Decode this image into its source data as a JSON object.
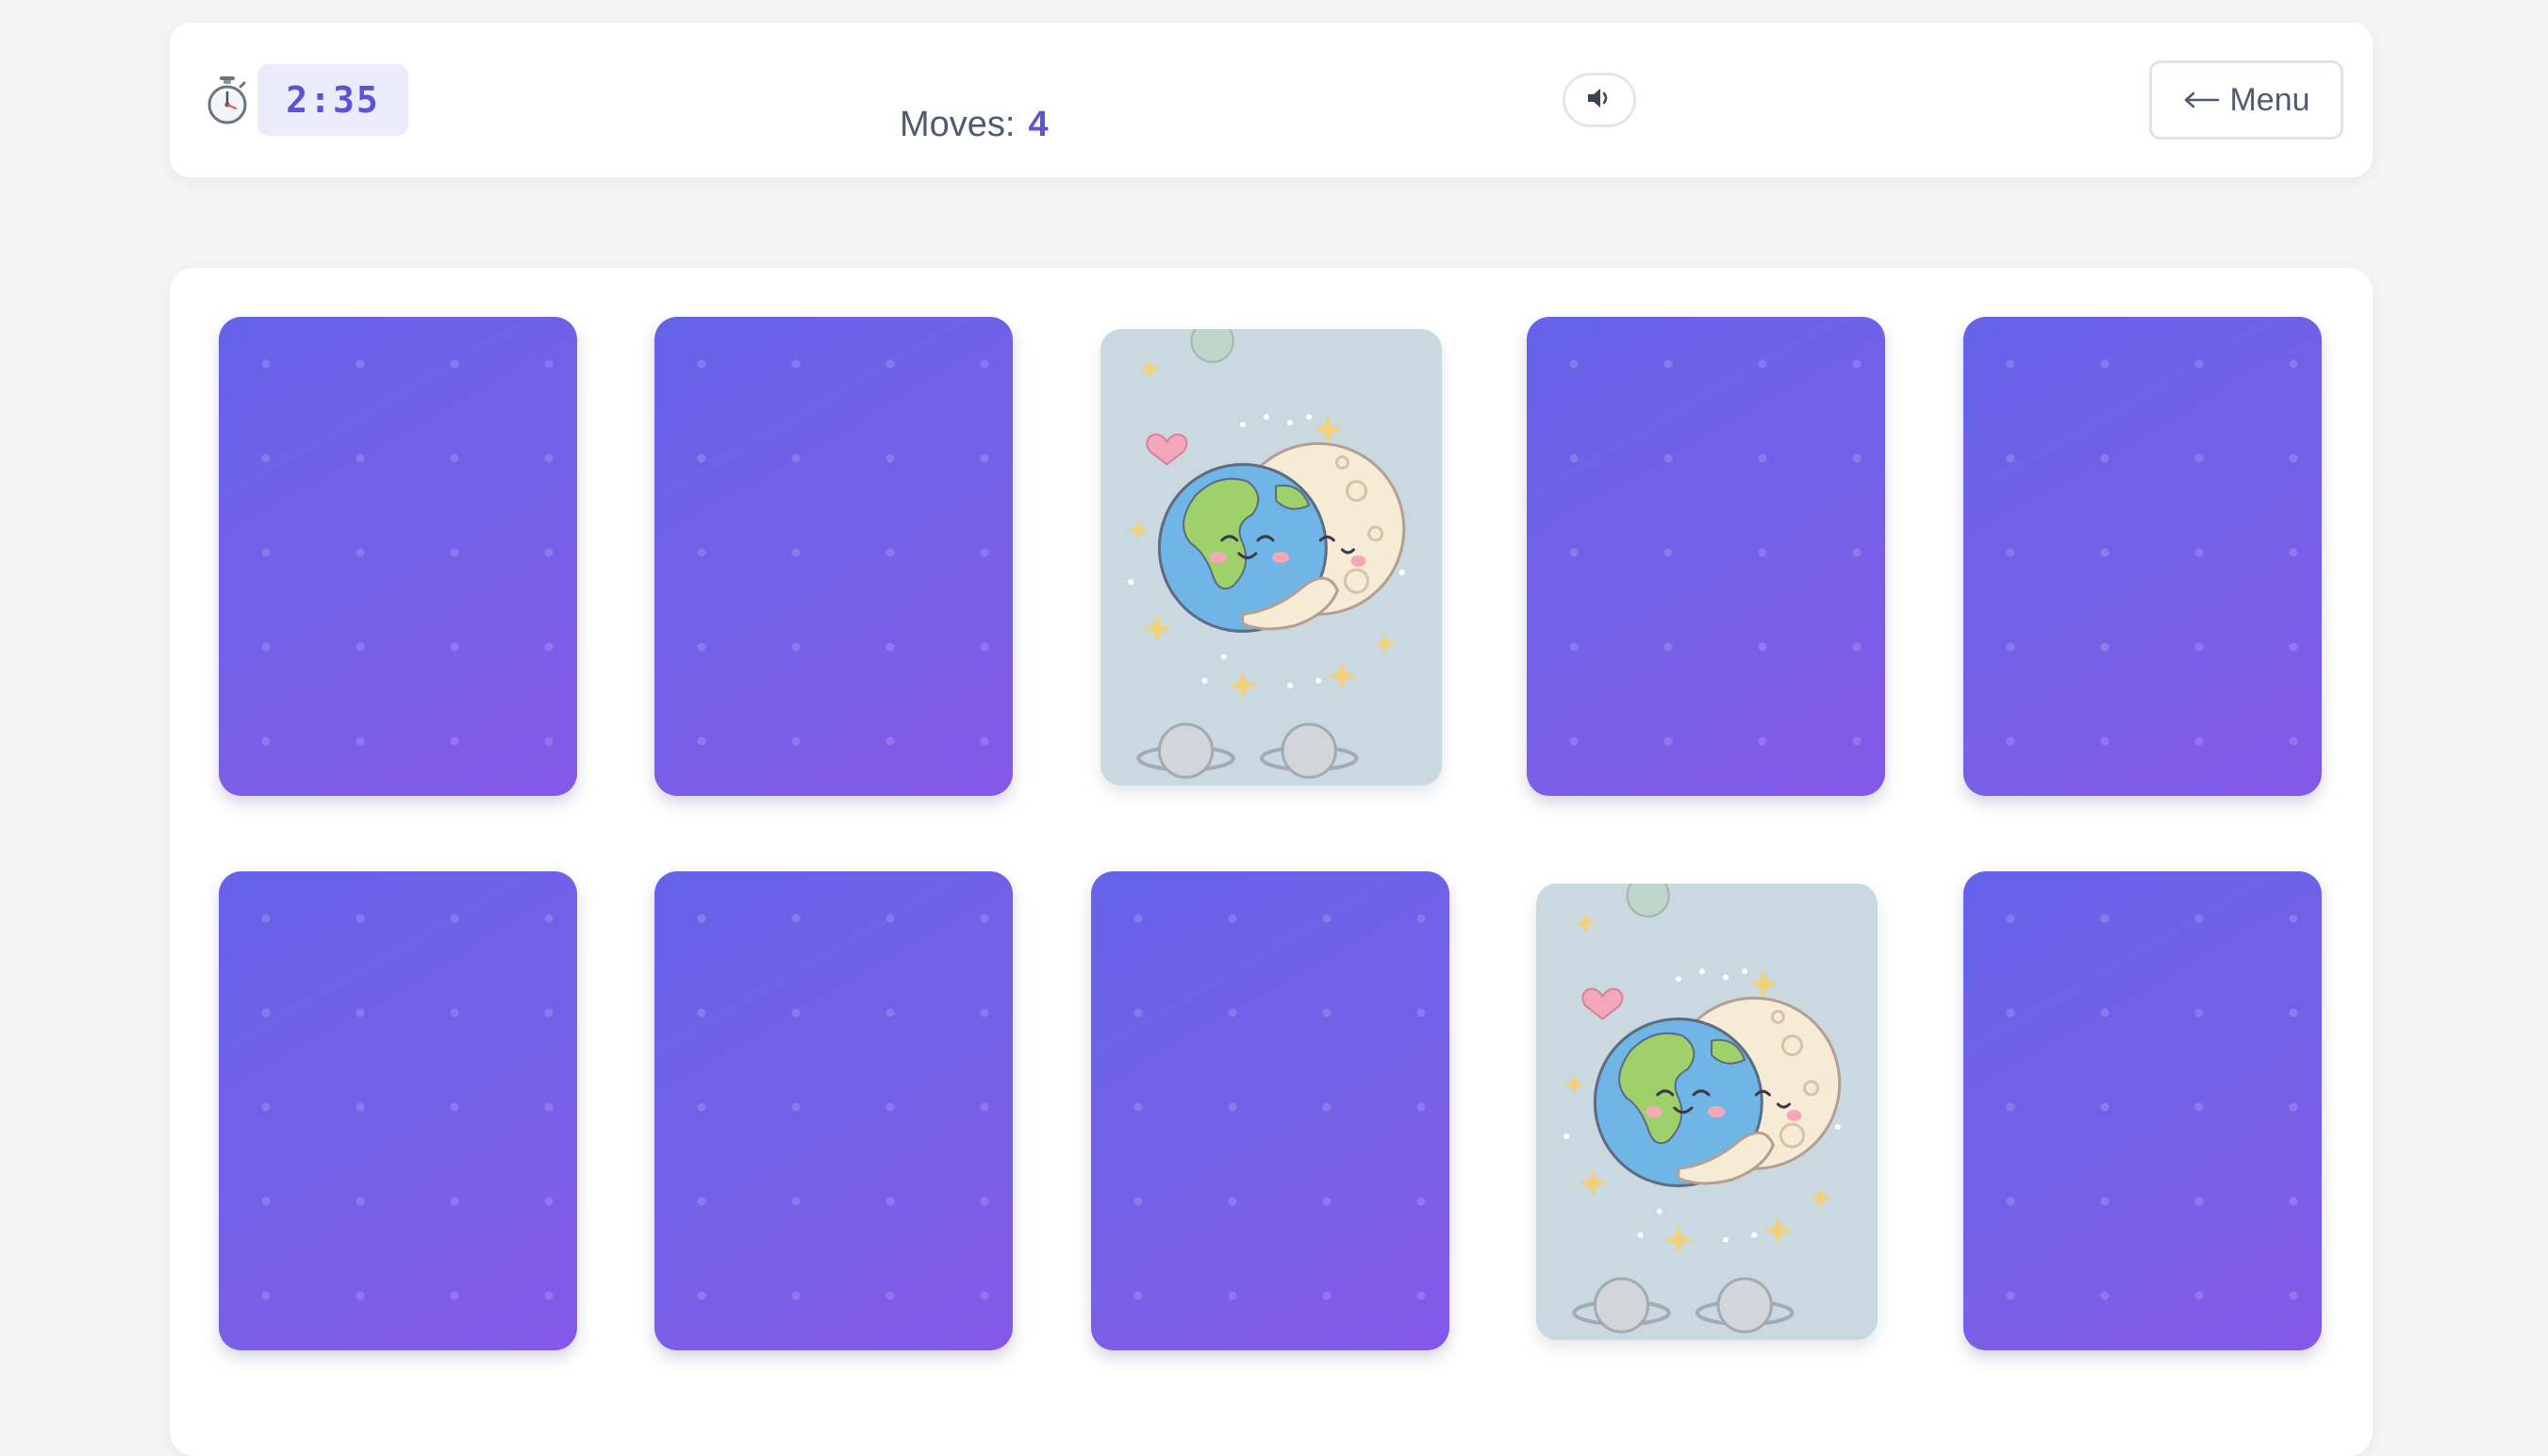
{
  "header": {
    "timer_icon": "stopwatch-icon",
    "timer_value": "2:35",
    "moves_label": "Moves:",
    "moves_value": "4",
    "sound_icon": "speaker-muted-icon",
    "menu_label": "Menu",
    "menu_icon": "arrow-left-icon"
  },
  "board": {
    "rows": 2,
    "columns": 5,
    "cards": [
      {
        "state": "face-down"
      },
      {
        "state": "face-down"
      },
      {
        "state": "face-up",
        "image": "earth-moon-hug"
      },
      {
        "state": "face-down"
      },
      {
        "state": "face-down"
      },
      {
        "state": "face-down"
      },
      {
        "state": "face-down"
      },
      {
        "state": "face-down"
      },
      {
        "state": "face-up",
        "image": "earth-moon-hug"
      },
      {
        "state": "face-down"
      }
    ]
  },
  "colors": {
    "accent": "#5b52d6",
    "card_back_start": "#6563e8",
    "card_back_end": "#8458e8",
    "timer_background": "#ecebfc",
    "card_front_background": "#cad9e0"
  }
}
